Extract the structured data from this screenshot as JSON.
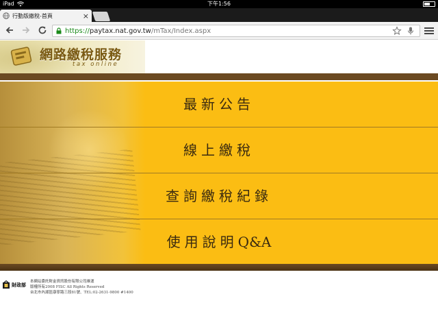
{
  "status_bar": {
    "device": "iPad",
    "time": "下午1:56"
  },
  "browser": {
    "tab": {
      "title": "行動版繳稅-首頁"
    },
    "url": {
      "scheme": "https://",
      "host": "paytax.nat.gov.tw",
      "path": "/mTax/Index.aspx"
    }
  },
  "header": {
    "logo_title": "網路繳稅服務",
    "logo_subtitle": "tax online"
  },
  "menu": {
    "items": [
      {
        "label": "最新公告"
      },
      {
        "label": "線上繳稅"
      },
      {
        "label": "查詢繳稅紀錄"
      },
      {
        "label_cjk": "使用說明",
        "label_latin": "Q&A"
      }
    ]
  },
  "footer": {
    "logo_name": "財政部",
    "lines": [
      "本網站委託財金資訊股份有限公司維運",
      "版權所有2008 FISC All Rights Reserved",
      "台北市內湖區康寧路三段81號、TEL:02-2631-9800 #1400"
    ]
  },
  "colors": {
    "menu_background": "#fbbd13",
    "bar_brown": "#6b4a22",
    "menu_text": "#3a2a10",
    "url_secure_green": "#1a8a1a"
  }
}
